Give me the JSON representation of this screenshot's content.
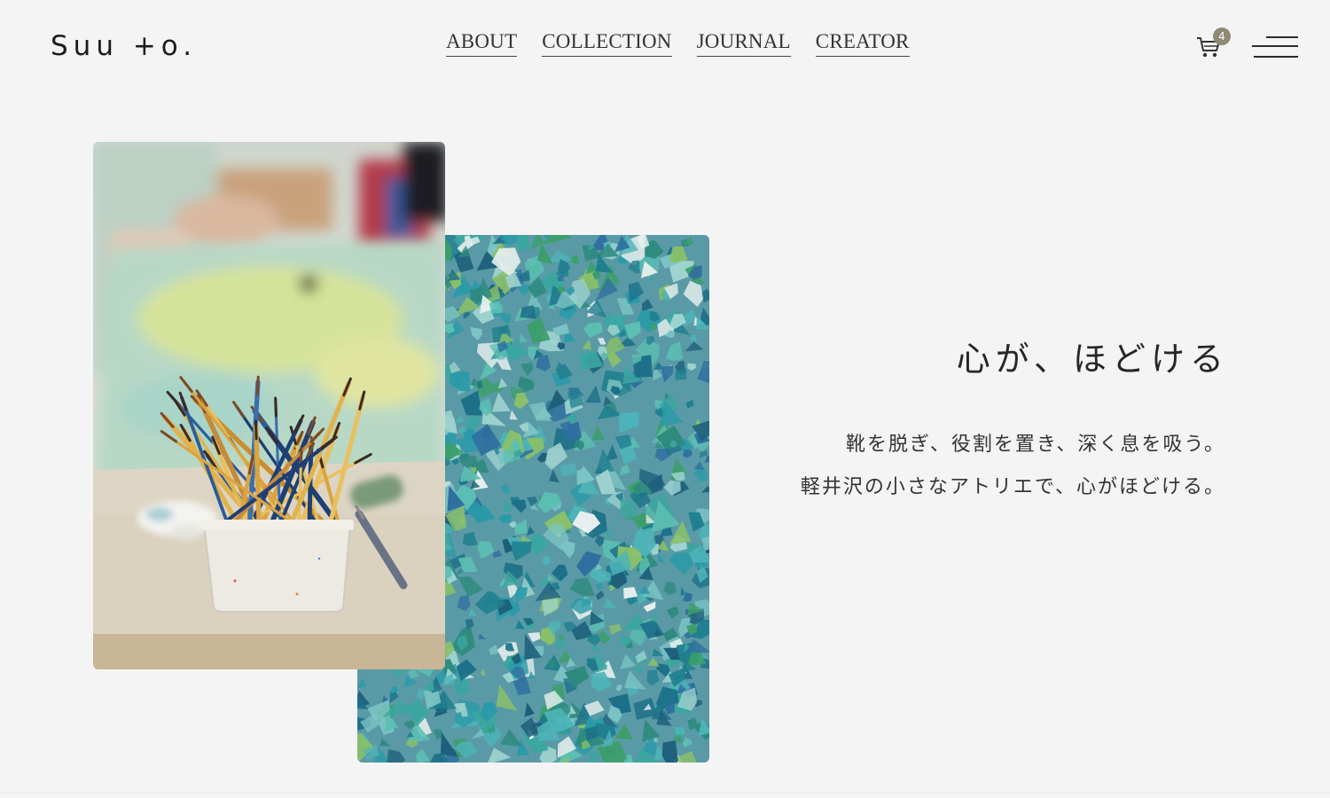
{
  "brand": {
    "logo_text": "Suu +o."
  },
  "nav": {
    "items": [
      {
        "label": "ABOUT"
      },
      {
        "label": "COLLECTION"
      },
      {
        "label": "JOURNAL"
      },
      {
        "label": "CREATOR"
      }
    ]
  },
  "cart": {
    "count": "4",
    "icon": "cart-icon"
  },
  "menu": {
    "icon": "hamburger-menu-icon"
  },
  "hero": {
    "headline": "心が、ほどける",
    "lines": [
      "靴を脱ぎ、役割を置き、深く息を吸う。",
      "軽井沢の小さなアトリエで、心がほどける。"
    ]
  },
  "colors": {
    "background": "#f4f4f4",
    "text": "#2b2b2b",
    "badge": "#8e8a74",
    "mosaic_base": "#2e8a9e"
  }
}
